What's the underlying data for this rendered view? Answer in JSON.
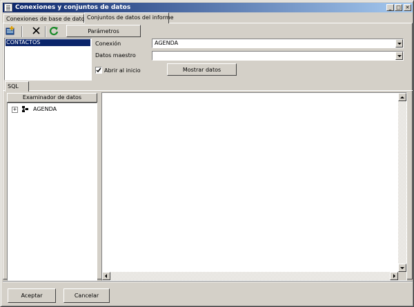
{
  "window": {
    "title": "Conexiones y conjuntos de datos"
  },
  "titlebar_buttons": {
    "minimize": "_",
    "maximize": "□",
    "close": "✕"
  },
  "tabs": [
    {
      "label": "Conexiones de base de datos",
      "active": false
    },
    {
      "label": "Conjuntos de datos del informe",
      "active": true
    }
  ],
  "toolbar": {
    "params_label": "Parámetros",
    "icons": [
      "add-dataset-icon",
      "delete-icon",
      "refresh-icon"
    ]
  },
  "datasets": {
    "items": [
      "CONTACTOS"
    ],
    "selected": "CONTACTOS"
  },
  "form": {
    "connection_label": "Conexión",
    "connection_value": "AGENDA",
    "master_label": "Datos maestro",
    "master_value": "",
    "open_at_start_label": "Abrir al inicio",
    "open_at_start_checked": true,
    "show_data_label": "Mostrar datos"
  },
  "sql_tab": {
    "label": "SQL"
  },
  "explorer": {
    "header": "Examinador de datos",
    "tree": [
      {
        "label": "AGENDA",
        "expander": "+"
      }
    ]
  },
  "footer": {
    "accept_label": "Aceptar",
    "cancel_label": "Cancelar"
  },
  "colors": {
    "face": "#d4d0c8",
    "title_start": "#0a246a",
    "title_end": "#a6caf0",
    "selection": "#0a246a"
  }
}
